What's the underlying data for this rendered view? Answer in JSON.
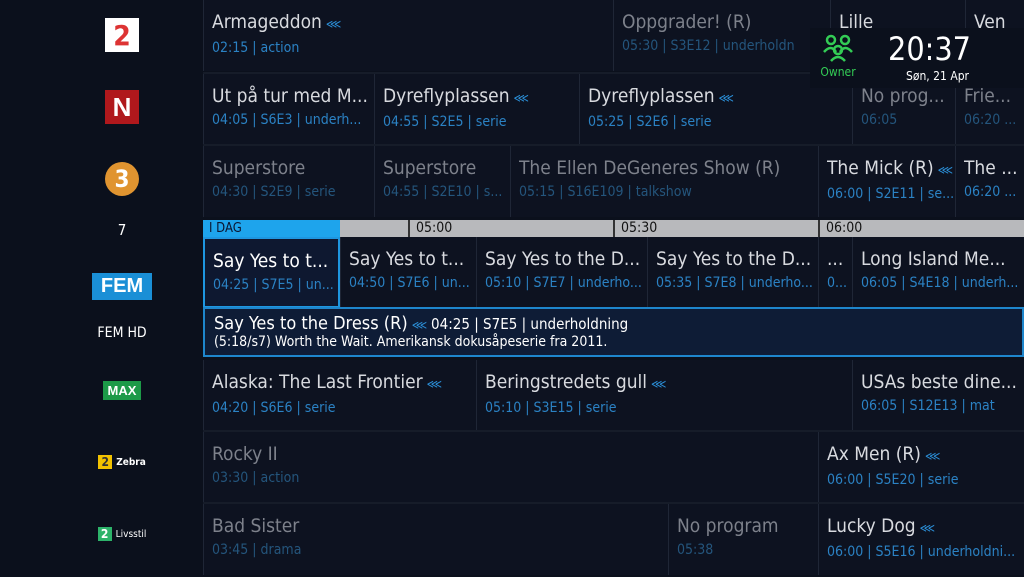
{
  "channels": [
    {
      "name": "TV 2",
      "logo_text": "2"
    },
    {
      "name": "NRK",
      "logo_text": "N"
    },
    {
      "name": "TV3",
      "logo_text": "3"
    },
    {
      "name": "7",
      "logo_text": "7"
    },
    {
      "name": "FEM",
      "logo_text": "FEM"
    },
    {
      "name": "FEM HD",
      "logo_text": "FEM HD"
    },
    {
      "name": "MAX",
      "logo_text": "MAX"
    },
    {
      "name": "TV 2 Zebra",
      "logo_text": "Zebra",
      "badge": "2"
    },
    {
      "name": "TV 2 Livsstil",
      "logo_text": "Livsstil",
      "badge": "2"
    }
  ],
  "timebar": {
    "today": "I DAG",
    "ticks": [
      "05:00",
      "05:30",
      "06:00"
    ]
  },
  "rows": [
    {
      "programs": [
        {
          "title": "Armageddon",
          "meta": "02:15 | action",
          "rec": true
        },
        {
          "title": "Oppgrader! (R)",
          "meta": "05:30 | S3E12 | underholdn",
          "past": true
        },
        {
          "title": "Lille",
          "meta": ""
        },
        {
          "title": "Ven",
          "meta": ""
        }
      ]
    },
    {
      "programs": [
        {
          "title": "Ut på tur med M...",
          "meta": "04:05 | S6E3 | underh..."
        },
        {
          "title": "Dyreflyplassen",
          "meta": "04:55 | S2E5 | serie",
          "rec": true
        },
        {
          "title": "Dyreflyplassen",
          "meta": "05:25 | S2E6 | serie",
          "rec": true
        },
        {
          "title": "No prog...",
          "meta": "06:05",
          "past": true
        },
        {
          "title": "Frie...",
          "meta": "06:20 ...",
          "past": true
        }
      ]
    },
    {
      "programs": [
        {
          "title": "Superstore",
          "meta": "04:30 | S2E9 | serie",
          "past": true
        },
        {
          "title": "Superstore",
          "meta": "04:55 | S2E10 | s...",
          "past": true
        },
        {
          "title": "The Ellen DeGeneres Show (R)",
          "meta": "05:15 | S16E109 | talkshow",
          "past": true
        },
        {
          "title": "The Mick (R)",
          "meta": "06:00 | S2E11 | se...",
          "rec": true
        },
        {
          "title": "The ...",
          "meta": "06:20 ..."
        }
      ]
    },
    {
      "programs": [
        {
          "title": "Say Yes to t...",
          "meta": "04:25 | S7E5 | un...",
          "selected": true
        },
        {
          "title": "Say Yes to t...",
          "meta": "04:50 | S7E6 | un..."
        },
        {
          "title": "Say Yes to the D...",
          "meta": "05:10 | S7E7 | underho..."
        },
        {
          "title": "Say Yes to the D...",
          "meta": "05:35 | S7E8 | underho..."
        },
        {
          "title": "...",
          "meta": "0...",
          "start": "06:00"
        },
        {
          "title": "Long Island Me...",
          "meta": "06:05 | S4E18 | underh..."
        }
      ]
    },
    {
      "programs": [
        {
          "title": "Alaska: The Last Frontier",
          "meta": "04:20 | S6E6 | serie",
          "rec": true
        },
        {
          "title": "Beringstredets gull",
          "meta": "05:10 | S3E15 | serie",
          "rec": true
        },
        {
          "title": "USAs beste dine...",
          "meta": "06:05 | S12E13 | mat"
        }
      ]
    },
    {
      "programs": [
        {
          "title": "Rocky II",
          "meta": "03:30 | action",
          "past": true
        },
        {
          "title": "Ax Men (R)",
          "meta": "06:00 | S5E20 | serie",
          "rec": true
        }
      ]
    },
    {
      "programs": [
        {
          "title": "Bad Sister",
          "meta": "03:45 | drama",
          "past": true
        },
        {
          "title": "No program",
          "meta": "05:38",
          "past": true
        },
        {
          "title": "Lucky Dog",
          "meta": "06:00 | S5E16 | underholdni...",
          "rec": true
        }
      ]
    }
  ],
  "details": {
    "title": "Say Yes to the Dress (R)",
    "meta": "04:25 | S7E5 | underholdning",
    "description": "(5:18/s7) Worth the Wait. Amerikansk dokusåpeserie fra 2011."
  },
  "status": {
    "profile": "Owner",
    "time": "20:37",
    "date": "Søn, 21 Apr",
    "profile_color": "#33cc55",
    "accent": "#1ea4ec"
  }
}
